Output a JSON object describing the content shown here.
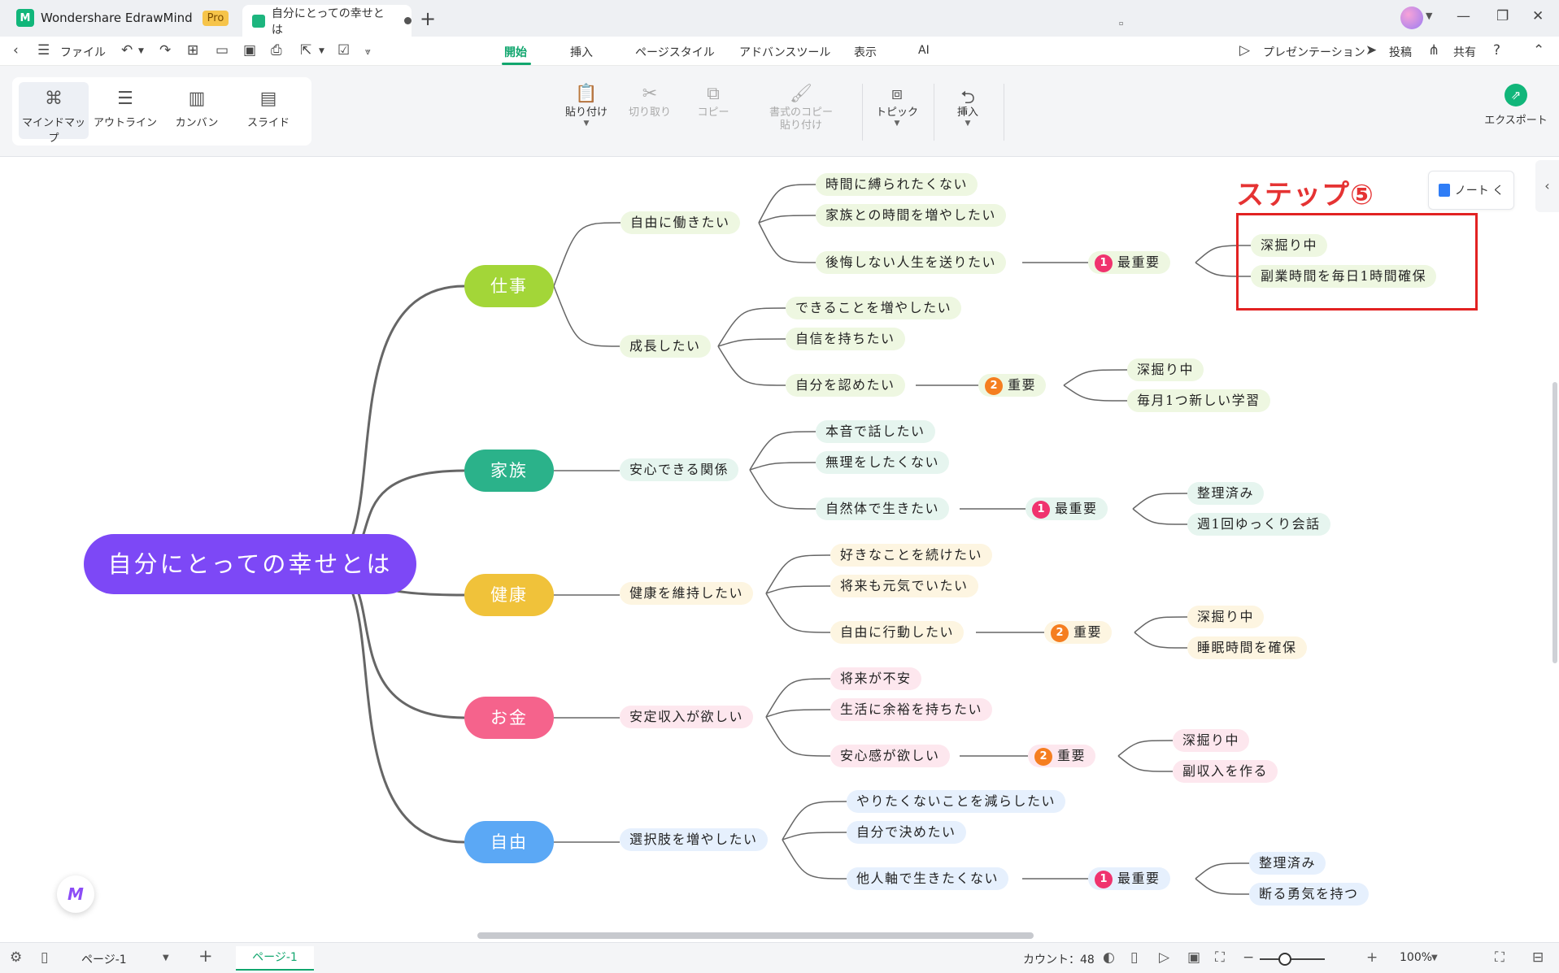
{
  "titlebar": {
    "app_name": "Wondershare EdrawMind",
    "pro_badge": "Pro",
    "doc_tab_title": "自分にとっての幸せとは"
  },
  "menubar": {
    "file": "ファイル",
    "tabs": [
      "開始",
      "挿入",
      "ページスタイル",
      "アドバンスツール",
      "表示",
      "AI"
    ],
    "active_tab": "開始",
    "presentation": "プレゼンテーション",
    "post": "投稿",
    "share": "共有"
  },
  "ribbon": {
    "views": [
      "マインドマップ",
      "アウトライン",
      "カンバン",
      "スライド"
    ],
    "paste": "貼り付け",
    "cut": "切り取り",
    "copy": "コピー",
    "format_copy_line1": "書式のコピー",
    "format_copy_line2": "貼り付け",
    "topic": "トピック",
    "insert": "挿入",
    "export": "エクスポート"
  },
  "canvas": {
    "step_label": "ステップ⑤",
    "note_button": "ノート く"
  },
  "mindmap": {
    "root": "自分にとっての幸せとは",
    "branches": {
      "work": {
        "label": "仕事",
        "color": "#a3d638",
        "sub1": {
          "label": "自由に働きたい",
          "leaf1": "時間に縛られたくない",
          "leaf2": "家族との時間を増やしたい",
          "leaf3": "後悔しない人生を送りたい",
          "priority_num": "1",
          "priority_label": "最重要",
          "detail1": "深掘り中",
          "detail2": "副業時間を毎日1時間確保"
        },
        "sub2": {
          "label": "成長したい",
          "leaf1": "できることを増やしたい",
          "leaf2": "自信を持ちたい",
          "leaf3": "自分を認めたい",
          "priority_num": "2",
          "priority_label": "重要",
          "detail1": "深掘り中",
          "detail2": "毎月1つ新しい学習"
        }
      },
      "family": {
        "label": "家族",
        "color": "#2bb28a",
        "sub": {
          "label": "安心できる関係",
          "leaf1": "本音で話したい",
          "leaf2": "無理をしたくない",
          "leaf3": "自然体で生きたい",
          "priority_num": "1",
          "priority_label": "最重要",
          "detail1": "整理済み",
          "detail2": "週1回ゆっくり会話"
        }
      },
      "health": {
        "label": "健康",
        "color": "#f0c23a",
        "sub": {
          "label": "健康を維持したい",
          "leaf1": "好きなことを続けたい",
          "leaf2": "将来も元気でいたい",
          "leaf3": "自由に行動したい",
          "priority_num": "2",
          "priority_label": "重要",
          "detail1": "深掘り中",
          "detail2": "睡眠時間を確保"
        }
      },
      "money": {
        "label": "お金",
        "color": "#f5638c",
        "sub": {
          "label": "安定収入が欲しい",
          "leaf1": "将来が不安",
          "leaf2": "生活に余裕を持ちたい",
          "leaf3": "安心感が欲しい",
          "priority_num": "2",
          "priority_label": "重要",
          "detail1": "深掘り中",
          "detail2": "副収入を作る"
        }
      },
      "freedom": {
        "label": "自由",
        "color": "#5ba8f5",
        "sub": {
          "label": "選択肢を増やしたい",
          "leaf1": "やりたくないことを減らしたい",
          "leaf2": "自分で決めたい",
          "leaf3": "他人軸で生きたくない",
          "priority_num": "1",
          "priority_label": "最重要",
          "detail1": "整理済み",
          "detail2": "断る勇気を持つ"
        }
      }
    }
  },
  "statusbar": {
    "page_select": "ページ-1",
    "page_tab": "ページ-1",
    "count": "カウント：48",
    "zoom": "100%"
  }
}
